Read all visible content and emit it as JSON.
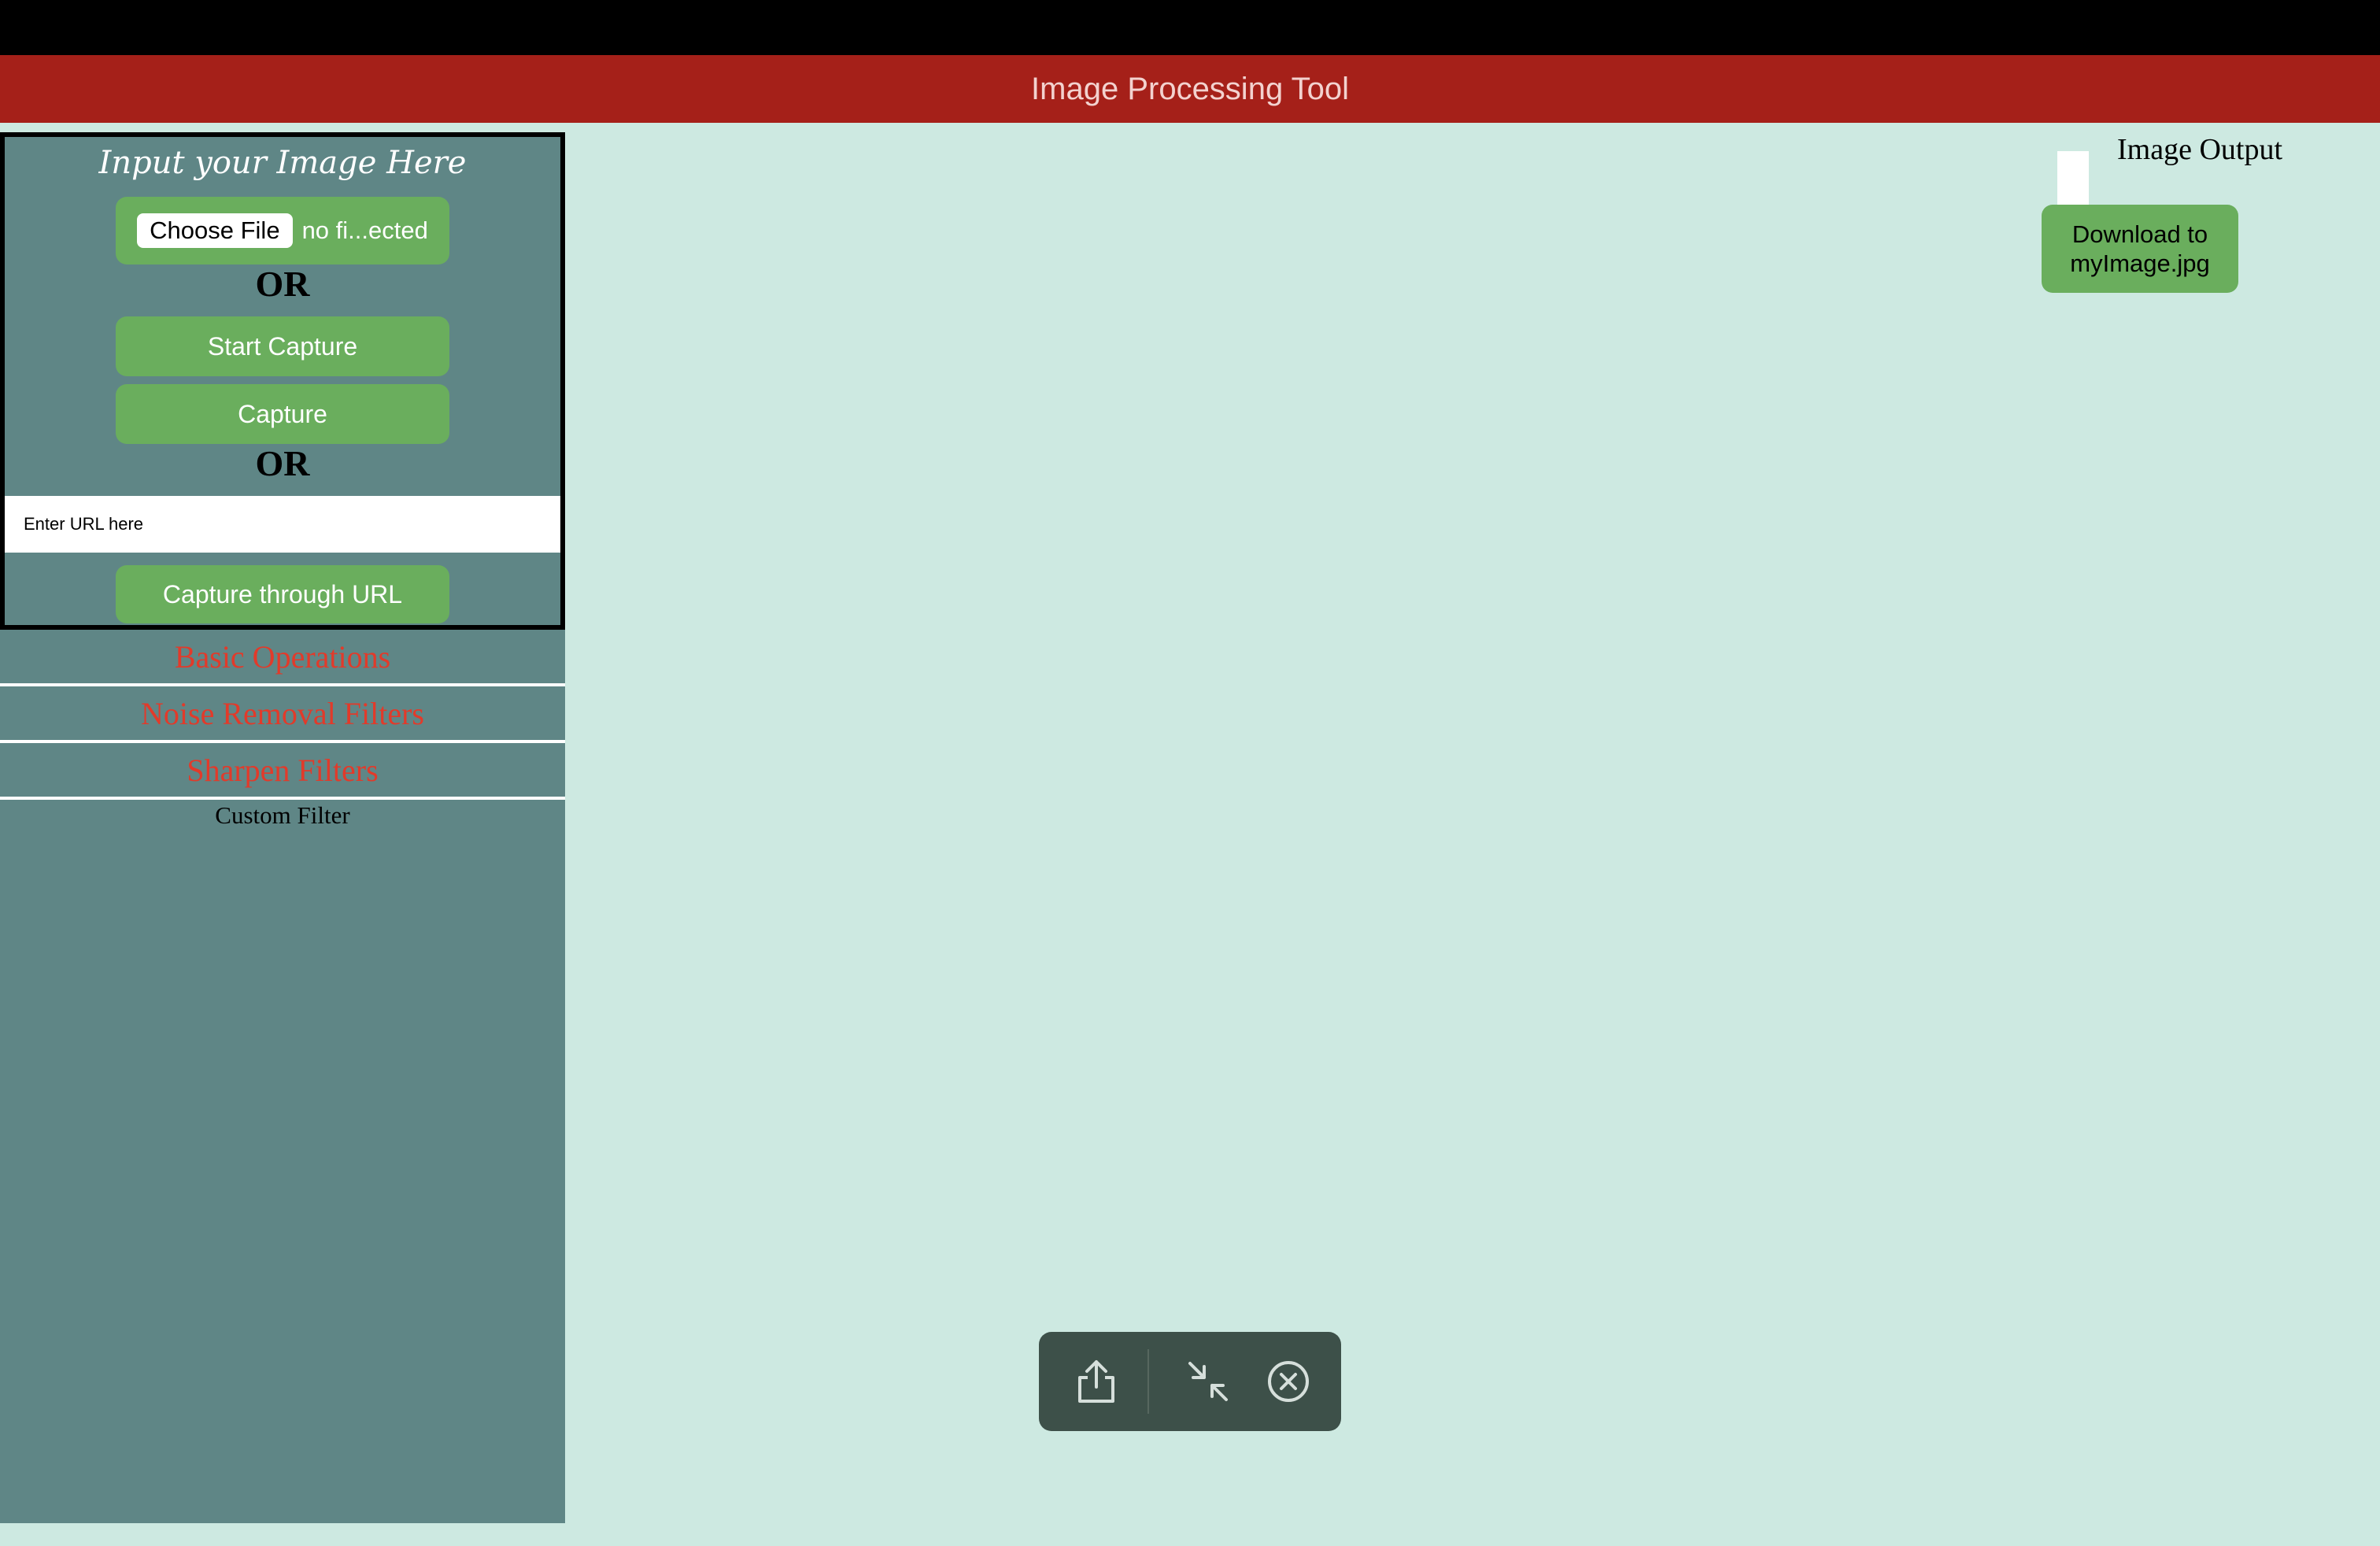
{
  "app": {
    "title": "Image Processing Tool"
  },
  "input_panel": {
    "title": "Input your Image Here",
    "choose_file_label": "Choose File",
    "file_status": "no fi...ected",
    "or_1": "OR",
    "start_capture_label": "Start Capture",
    "capture_label": "Capture",
    "or_2": "OR",
    "url_placeholder": "Enter URL here",
    "capture_url_label": "Capture through URL"
  },
  "menu": {
    "items": [
      {
        "label": "Basic Operations"
      },
      {
        "label": "Noise Removal Filters"
      },
      {
        "label": "Sharpen Filters"
      }
    ],
    "custom_filter_label": "Custom Filter"
  },
  "output": {
    "title": "Image Output",
    "download_label": "Download to myImage.jpg"
  },
  "toolbar": {
    "icons": [
      "share-icon",
      "shrink-icon",
      "close-circle-icon"
    ]
  },
  "colors": {
    "header_bg": "#a52019",
    "sidebar_bg": "#5f8686",
    "page_bg": "#cde9e1",
    "button_green": "#6aae5d",
    "menu_text": "#e23a2a"
  }
}
